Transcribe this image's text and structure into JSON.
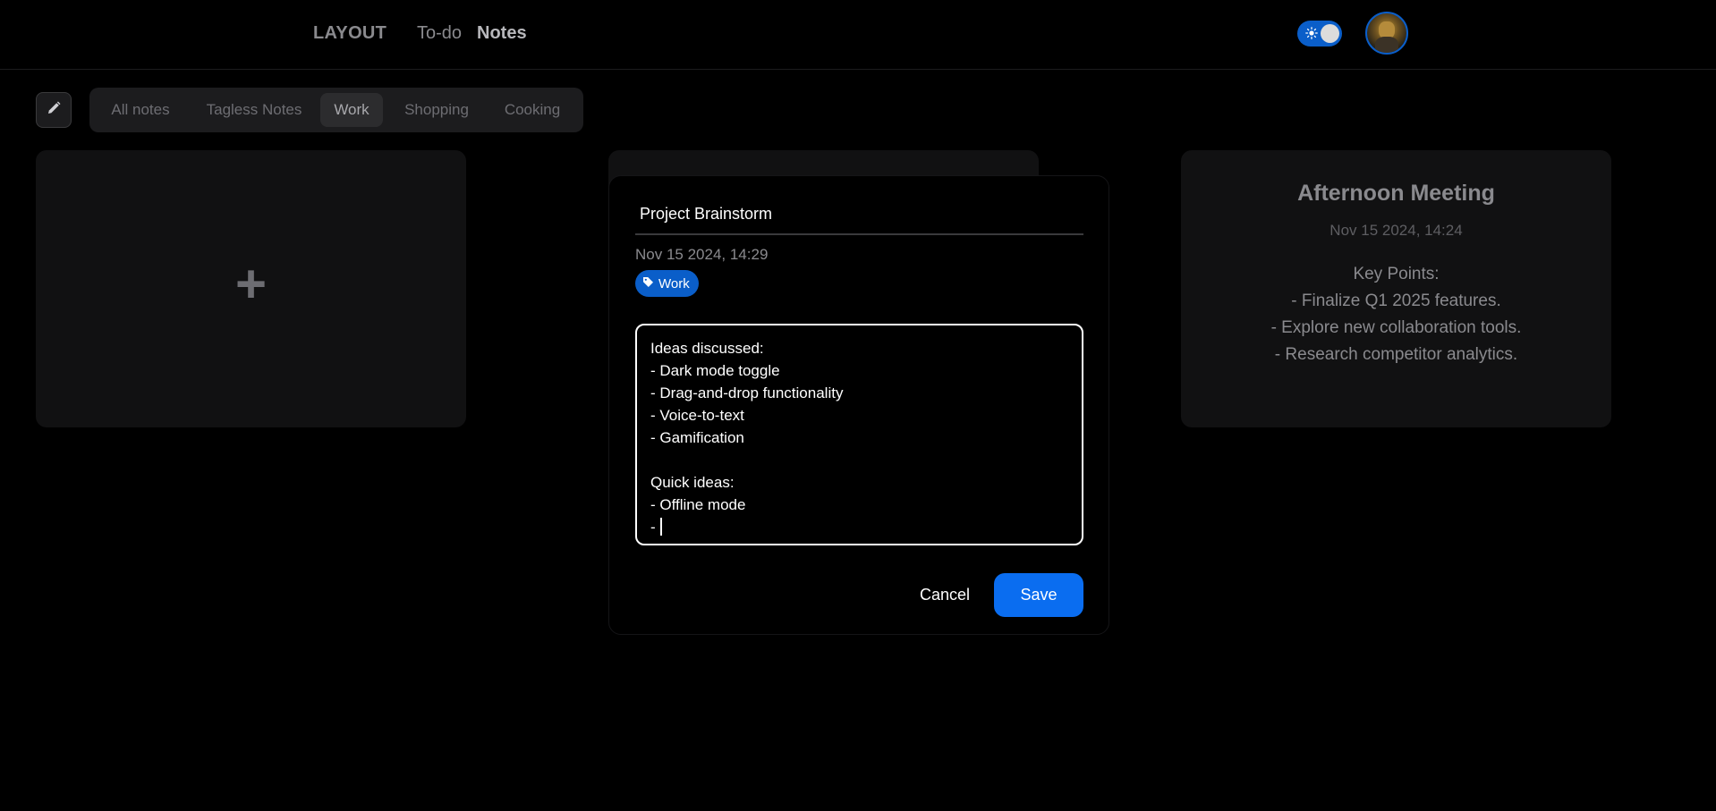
{
  "header": {
    "brand": "LAYOUT",
    "nav": {
      "todo": "To-do",
      "notes": "Notes"
    },
    "theme_toggle": {
      "icon": "sun-icon",
      "state": "on"
    },
    "avatar": {
      "icon": "user-avatar"
    }
  },
  "toolbar": {
    "edit_icon": "pencil-icon",
    "tags": [
      {
        "label": "All notes"
      },
      {
        "label": "Tagless Notes"
      },
      {
        "label": "Work",
        "active": true
      },
      {
        "label": "Shopping"
      },
      {
        "label": "Cooking"
      }
    ]
  },
  "cards": {
    "add": {
      "icon": "plus-icon",
      "symbol": "+"
    },
    "right": {
      "title": "Afternoon Meeting",
      "date": "Nov 15 2024, 14:24",
      "lines": [
        "Key Points:",
        "- Finalize Q1 2025 features.",
        "- Explore new collaboration tools.",
        "- Research competitor analytics."
      ]
    }
  },
  "modal": {
    "title_value": "Project Brainstorm",
    "date": "Nov 15 2024, 14:29",
    "tag": {
      "label": "Work",
      "icon": "tag-icon"
    },
    "content": "Ideas discussed:\n- Dark mode toggle\n- Drag-and-drop functionality\n- Voice-to-text\n- Gamification\n\nQuick ideas:\n- Offline mode\n- ",
    "cancel_label": "Cancel",
    "save_label": "Save"
  },
  "colors": {
    "background": "#000000",
    "accent": "#0a6df0",
    "card": "#111112"
  }
}
